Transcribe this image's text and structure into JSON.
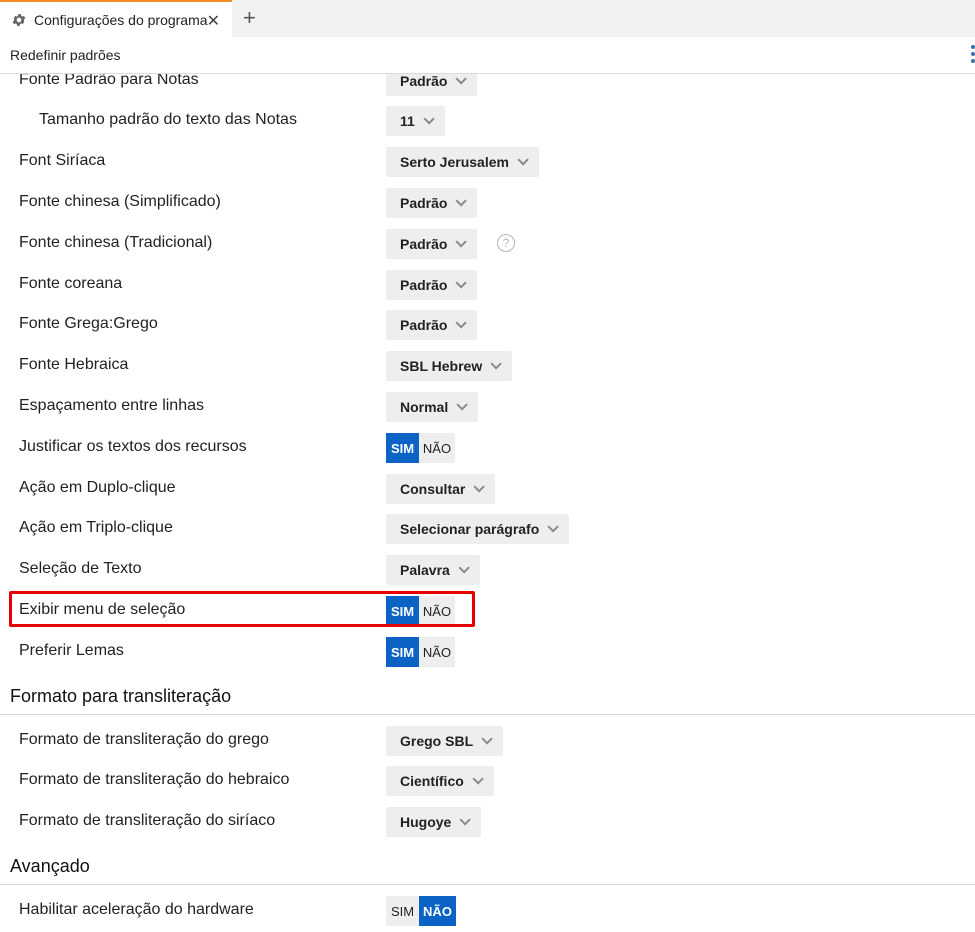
{
  "tab": {
    "title": "Configurações do programa",
    "close": "✕",
    "new": "+"
  },
  "toolbar": {
    "reset_label": "Redefinir padrões"
  },
  "settings": [
    {
      "label": "Fonte Padrão para Notas",
      "type": "dropdown",
      "value": "Padrão"
    },
    {
      "label": "Tamanho padrão do texto das Notas",
      "type": "dropdown",
      "value": "11",
      "indent": true
    },
    {
      "label": "Font Siríaca",
      "type": "dropdown",
      "value": "Serto Jerusalem"
    },
    {
      "label": "Fonte chinesa (Simplificado)",
      "type": "dropdown",
      "value": "Padrão"
    },
    {
      "label": "Fonte chinesa (Tradicional)",
      "type": "dropdown",
      "value": "Padrão",
      "help": "?"
    },
    {
      "label": "Fonte coreana",
      "type": "dropdown",
      "value": "Padrão"
    },
    {
      "label": "Fonte Grega:Grego",
      "type": "dropdown",
      "value": "Padrão"
    },
    {
      "label": "Fonte Hebraica",
      "type": "dropdown",
      "value": "SBL Hebrew"
    },
    {
      "label": "Espaçamento entre linhas",
      "type": "dropdown",
      "value": "Normal"
    },
    {
      "label": "Justificar os textos dos recursos",
      "type": "toggle",
      "yes": "SIM",
      "no": "NÃO",
      "selected": "yes"
    },
    {
      "label": "Ação em Duplo-clique",
      "type": "dropdown",
      "value": "Consultar"
    },
    {
      "label": "Ação em Triplo-clique",
      "type": "dropdown",
      "value": "Selecionar parágrafo"
    },
    {
      "label": "Seleção de Texto",
      "type": "dropdown",
      "value": "Palavra"
    },
    {
      "label": "Exibir menu de seleção",
      "type": "toggle",
      "yes": "SIM",
      "no": "NÃO",
      "selected": "yes"
    },
    {
      "label": "Preferir Lemas",
      "type": "toggle",
      "yes": "SIM",
      "no": "NÃO",
      "selected": "yes"
    }
  ],
  "sections": [
    {
      "title": "Formato para transliteração"
    },
    {
      "title": "Avançado"
    }
  ],
  "translit": [
    {
      "label": "Formato de transliteração do grego",
      "value": "Grego SBL"
    },
    {
      "label": "Formato de transliteração do hebraico",
      "value": "Científico"
    },
    {
      "label": "Formato de transliteração do siríaco",
      "value": "Hugoye"
    }
  ],
  "advanced": [
    {
      "label": "Habilitar aceleração do hardware",
      "yes": "SIM",
      "no": "NÃO",
      "selected": "no"
    }
  ],
  "colors": {
    "accent": "#0b63c5",
    "tab_border": "#f28c28",
    "highlight": "#e60000"
  }
}
